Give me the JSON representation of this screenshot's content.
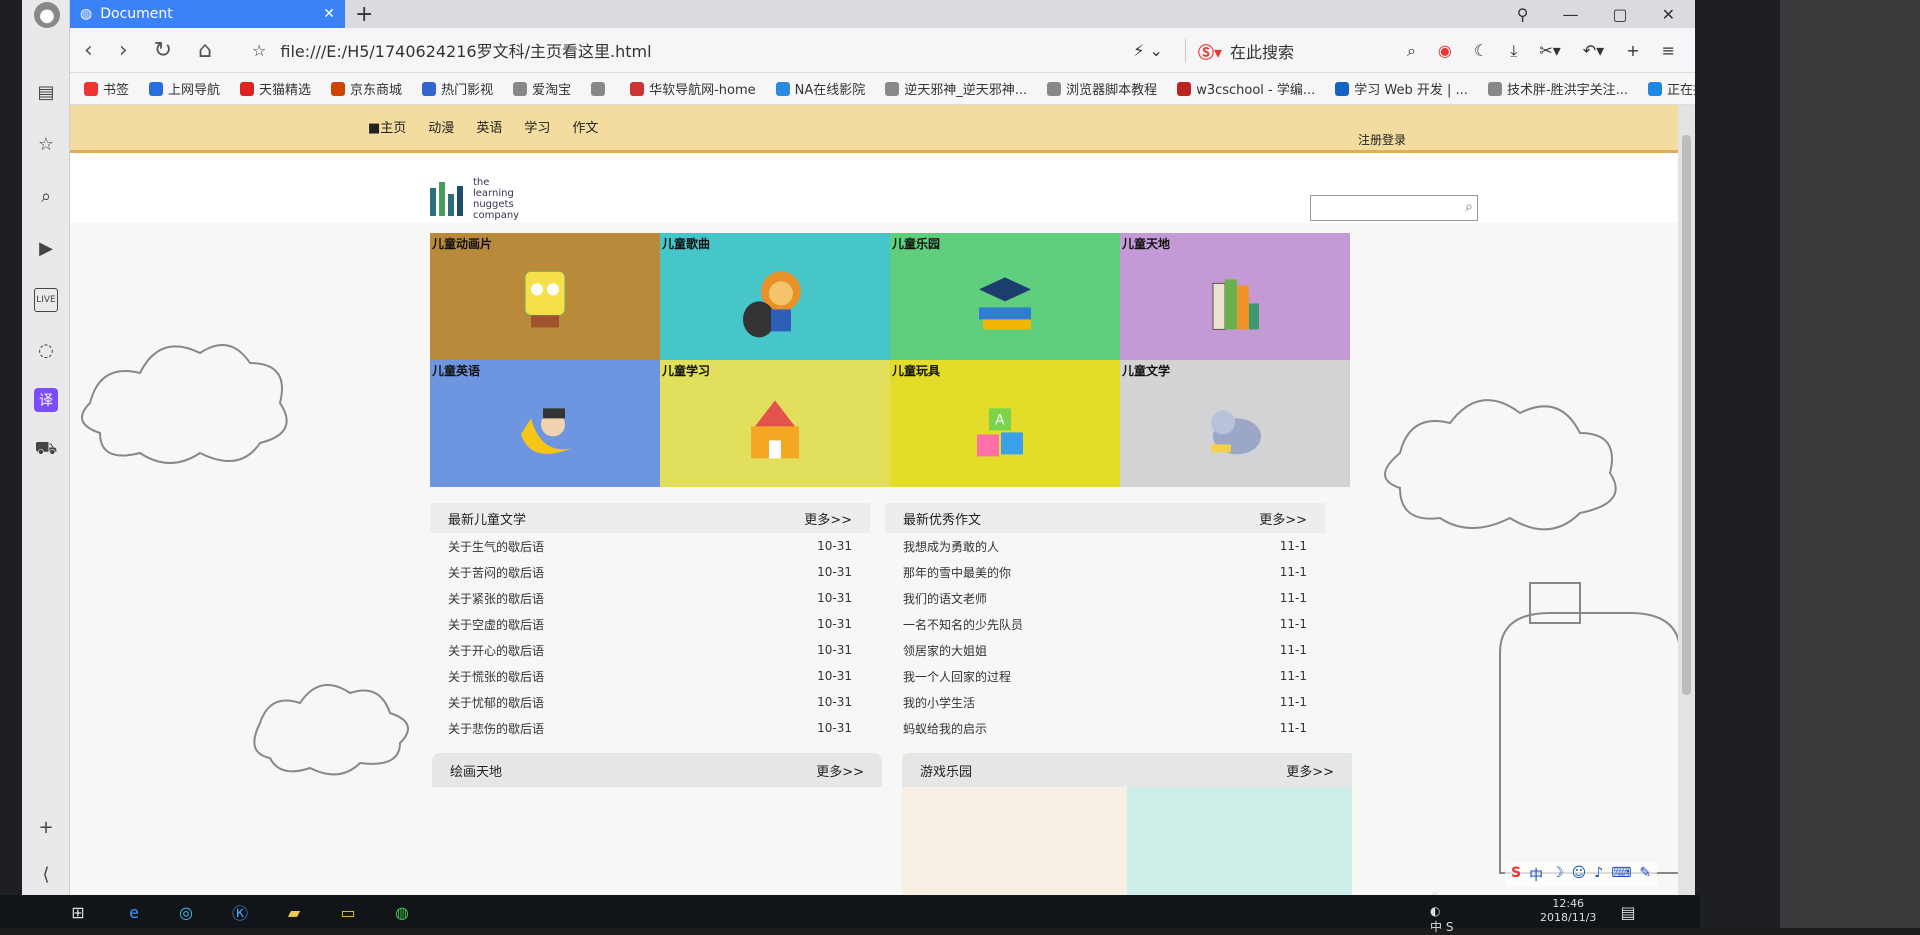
{
  "tab": {
    "title": "Document"
  },
  "address": {
    "url": "file:///E:/H5/1740624216罗文科/主页看这里.html",
    "search_placeholder": "在此搜索"
  },
  "bookmarks": [
    "书签",
    "上网导航",
    "天猫精选",
    "京东商城",
    "热门影视",
    "爱淘宝",
    "",
    "华软导航网-home",
    "NA在线影院",
    "逆天邪神_逆天邪神...",
    "浏览器脚本教程",
    "w3cschool - 学编...",
    "学习 Web 开发 | ...",
    "技术胖-胜洪宇关注...",
    "正在播放..."
  ],
  "site": {
    "nav": [
      "■主页",
      "动漫",
      "英语",
      "学习",
      "作文"
    ],
    "register": "注册登录",
    "logo_text": [
      "the",
      "learning",
      "nuggets",
      "company"
    ]
  },
  "categories": [
    {
      "label": "儿童动画片",
      "color": "#b88a3a",
      "icon": "sponge-character-icon"
    },
    {
      "label": "儿童歌曲",
      "color": "#46c6c8",
      "icon": "lion-drummer-icon"
    },
    {
      "label": "儿童乐园",
      "color": "#5fcf7d",
      "icon": "graduation-cap-books-icon"
    },
    {
      "label": "儿童天地",
      "color": "#c39ad6",
      "icon": "book-stack-icon"
    },
    {
      "label": "儿童英语",
      "color": "#6e96e0",
      "icon": "moon-child-icon"
    },
    {
      "label": "儿童学习",
      "color": "#e2df5c",
      "icon": "school-building-icon"
    },
    {
      "label": "儿童玩具",
      "color": "#e4dc28",
      "icon": "abc-blocks-icon"
    },
    {
      "label": "儿童文学",
      "color": "#d3d3d6",
      "icon": "elephant-icon"
    }
  ],
  "lists": [
    {
      "title": "最新儿童文学",
      "more": "更多>>",
      "items": [
        {
          "t": "关于生气的歇后语",
          "d": "10-31"
        },
        {
          "t": "关于苦闷的歇后语",
          "d": "10-31"
        },
        {
          "t": "关于紧张的歇后语",
          "d": "10-31"
        },
        {
          "t": "关于空虚的歇后语",
          "d": "10-31"
        },
        {
          "t": "关于开心的歇后语",
          "d": "10-31"
        },
        {
          "t": "关于慌张的歇后语",
          "d": "10-31"
        },
        {
          "t": "关于忧郁的歇后语",
          "d": "10-31"
        },
        {
          "t": "关于悲伤的歇后语",
          "d": "10-31"
        }
      ]
    },
    {
      "title": "最新优秀作文",
      "more": "更多>>",
      "items": [
        {
          "t": "我想成为勇敢的人",
          "d": "11-1"
        },
        {
          "t": "那年的雪中最美的你",
          "d": "11-1"
        },
        {
          "t": "我们的语文老师",
          "d": "11-1"
        },
        {
          "t": "一名不知名的少先队员",
          "d": "11-1"
        },
        {
          "t": "领居家的大姐姐",
          "d": "11-1"
        },
        {
          "t": "我一个人回家的过程",
          "d": "11-1"
        },
        {
          "t": "我的小学生活",
          "d": "11-1"
        },
        {
          "t": "蚂蚁给我的启示",
          "d": "11-1"
        }
      ]
    }
  ],
  "bottom": [
    {
      "title": "绘画天地",
      "more": "更多>>"
    },
    {
      "title": "游戏乐园",
      "more": "更多>>"
    }
  ],
  "ime": "中",
  "clock": {
    "time": "12:46",
    "date": "2018/11/3"
  }
}
